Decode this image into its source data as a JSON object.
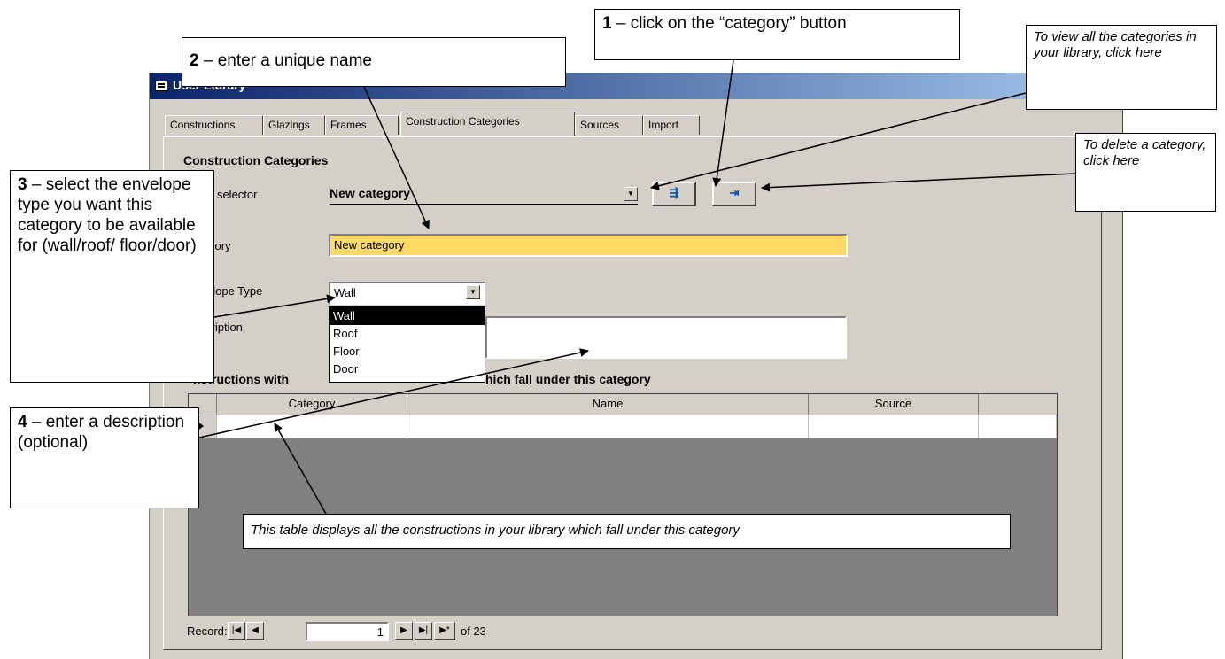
{
  "window": {
    "title": "User Library"
  },
  "tabs": [
    "Constructions",
    "Glazings",
    "Frames",
    "Construction Categories",
    "Sources",
    "Import"
  ],
  "form": {
    "section_title": "Construction Categories",
    "selector_label": "ect selector",
    "selector_value": "New category",
    "category_label": "egory",
    "category_value": "New category",
    "envelope_label": "elope Type",
    "envelope_value": "Wall",
    "envelope_options": [
      "Wall",
      "Roof",
      "Floor",
      "Door"
    ],
    "description_label": "cription",
    "constructions_heading_left": "nstructions with",
    "constructions_heading_right": "hich fall under this category"
  },
  "grid": {
    "columns": [
      "Category",
      "Name",
      "Source"
    ]
  },
  "record_nav": {
    "label": "Record:",
    "current": "1",
    "total_text": "of  23"
  },
  "callouts": {
    "c1": {
      "num": "1",
      "text": " – click on the “category” button"
    },
    "c2": {
      "num": "2",
      "text": " – enter a unique name"
    },
    "c3": {
      "num": "3",
      "text": " – select the envelope type you want this category to be available for (wall/roof/ floor/door)"
    },
    "c4": {
      "num": "4",
      "text": " – enter a description (optional)"
    },
    "view": "To view all the categories in your library, click here",
    "delete": "To delete a category, click here",
    "table": "This table displays all the constructions in your library which fall under this category"
  },
  "colors": {
    "title_start": "#0a246a",
    "title_end": "#a6caf0",
    "highlight_field": "#ffd966",
    "dialog_bg": "#d4d0c8",
    "grid_bg": "#808080"
  }
}
